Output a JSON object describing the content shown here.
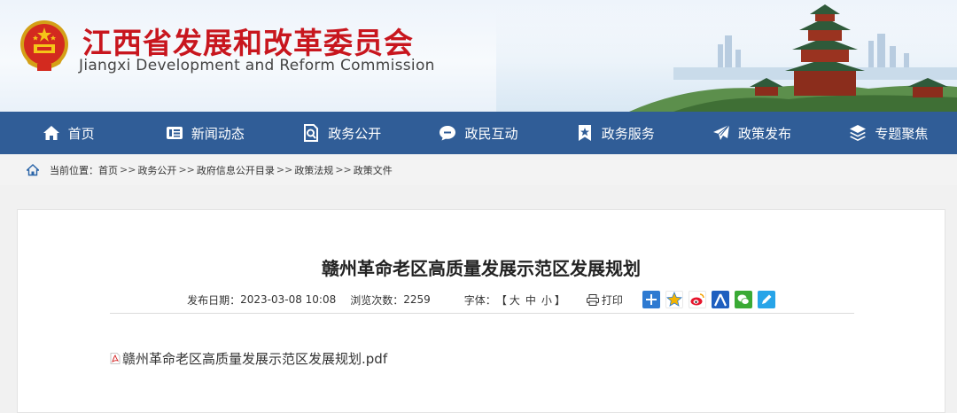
{
  "header": {
    "title_cn": "江西省发展和改革委员会",
    "title_en": "Jiangxi Development and Reform Commission"
  },
  "nav": {
    "items": [
      {
        "label": "首页",
        "icon": "home-icon"
      },
      {
        "label": "新闻动态",
        "icon": "news-icon"
      },
      {
        "label": "政务公开",
        "icon": "document-search-icon"
      },
      {
        "label": "政民互动",
        "icon": "chat-icon"
      },
      {
        "label": "政务服务",
        "icon": "bookmark-star-icon"
      },
      {
        "label": "政策发布",
        "icon": "paper-plane-icon"
      },
      {
        "label": "专题聚焦",
        "icon": "layers-icon"
      }
    ]
  },
  "breadcrumb": {
    "prefix": "当前位置：",
    "items": [
      "首页",
      "政务公开",
      "政府信息公开目录",
      "政策法规",
      "政策文件"
    ],
    "separator": ">>"
  },
  "article": {
    "title": "赣州革命老区高质量发展示范区发展规划",
    "date_label": "发布日期：",
    "date": "2023-03-08 10:08",
    "views_label": "浏览次数：",
    "views": "2259",
    "font_label": "字体：",
    "bracket_open": "【",
    "size_large": "大",
    "size_medium": "中",
    "size_small": "小",
    "bracket_close": "】",
    "print_label": "打印",
    "attachment": "赣州革命老区高质量发展示范区发展规划.pdf"
  },
  "share": [
    {
      "icon": "plus-share-icon",
      "color": "#2e7ad1"
    },
    {
      "icon": "qzone-star-icon",
      "color": "#f5b400"
    },
    {
      "icon": "weibo-icon",
      "color": "#e6162d"
    },
    {
      "icon": "renren-icon",
      "color": "#1f5fbf"
    },
    {
      "icon": "wechat-icon",
      "color": "#3aaa35"
    },
    {
      "icon": "pencil-share-icon",
      "color": "#27a4e8"
    }
  ],
  "colors": {
    "brand_red": "#c8161e",
    "nav_blue": "#305d97"
  }
}
